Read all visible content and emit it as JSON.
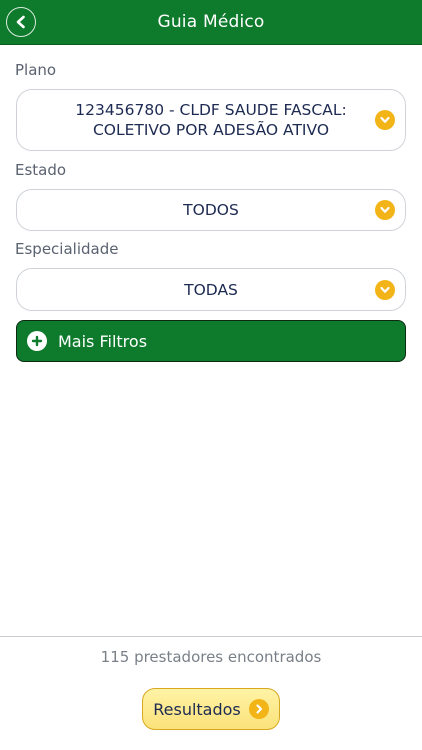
{
  "header": {
    "title": "Guia Médico",
    "back_icon": "chevron-left-icon"
  },
  "plano": {
    "label": "Plano",
    "value_line1": "123456780 - CLDF SAUDE FASCAL:",
    "value_line2": "COLETIVO POR ADESÃO ATIVO"
  },
  "estado": {
    "label": "Estado",
    "value": "TODOS"
  },
  "especialidade": {
    "label": "Especialidade",
    "value": "TODAS"
  },
  "filters": {
    "more_label": "Mais Filtros",
    "icon": "plus-circle-icon"
  },
  "footer": {
    "count_text": "115 prestadores encontrados",
    "results_label": "Resultados"
  },
  "colors": {
    "brand_green": "#0e7a2c",
    "accent_yellow": "#f2b417",
    "button_yellow": "#fbe27a"
  }
}
